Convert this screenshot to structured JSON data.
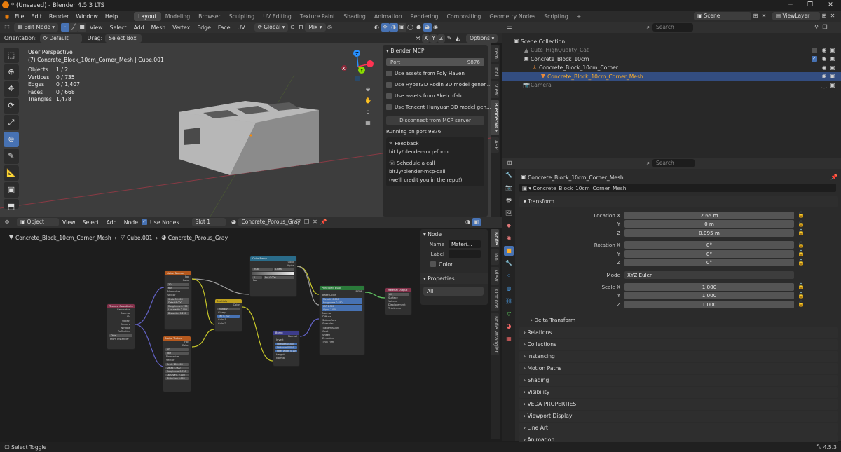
{
  "window": {
    "title": "* (Unsaved) - Blender 4.5.3 LTS",
    "min": "─",
    "max": "❐",
    "close": "✕"
  },
  "menu": [
    "File",
    "Edit",
    "Render",
    "Window",
    "Help"
  ],
  "workspaces": [
    "Layout",
    "Modeling",
    "Browser",
    "Sculpting",
    "UV Editing",
    "Texture Paint",
    "Shading",
    "Animation",
    "Rendering",
    "Compositing",
    "Geometry Nodes",
    "Scripting"
  ],
  "workspace_add": "+",
  "scene": "Scene",
  "view_layer": "ViewLayer",
  "viewport_header": {
    "mode": "Edit Mode",
    "view": "View",
    "select": "Select",
    "add": "Add",
    "mesh": "Mesh",
    "vertex": "Vertex",
    "edge": "Edge",
    "face": "Face",
    "uv": "UV",
    "transform": "Global",
    "snap": "Mix",
    "options": "Options",
    "axes": [
      "X",
      "Y",
      "Z"
    ]
  },
  "viewport_sub": {
    "orientation_label": "Orientation:",
    "orientation": "Default",
    "drag_label": "Drag:",
    "drag": "Select Box"
  },
  "viewport_info": {
    "perspective": "User Perspective",
    "object": "(7) Concrete_Block_10cm_Corner_Mesh | Cube.001"
  },
  "stats": [
    {
      "k": "Objects",
      "v": "1 / 2"
    },
    {
      "k": "Vertices",
      "v": "0 / 735"
    },
    {
      "k": "Edges",
      "v": "0 / 1,407"
    },
    {
      "k": "Faces",
      "v": "0 / 668"
    },
    {
      "k": "Triangles",
      "v": "1,478"
    }
  ],
  "gizmo": {
    "x": "X",
    "y": "Y",
    "z": "Z"
  },
  "mcp": {
    "title": "Blender MCP",
    "port_label": "Port",
    "port_value": "9876",
    "options": [
      "Use assets from Poly Haven",
      "Use Hyper3D Rodin 3D model gener...",
      "Use assets from Sketchfab",
      "Use Tencent Hunyuan 3D model gen..."
    ],
    "disconnect": "Disconnect from MCP server",
    "running": "Running on port 9876",
    "feedback": "Feedback",
    "feedback_url": "bit.ly/blender-mcp-form",
    "schedule": "Schedule a call",
    "schedule_url": "bit.ly/blender-mcp-call",
    "credit": "(we'll credit you in the repo!)"
  },
  "viewport_tabs": [
    "Item",
    "Tool",
    "View",
    "BlenderMCP",
    "ASP"
  ],
  "node_header": {
    "type": "Object",
    "view": "View",
    "select": "Select",
    "add": "Add",
    "node": "Node",
    "use_nodes": "Use Nodes",
    "slot": "Slot 1",
    "material": "Concrete_Porous_Gray"
  },
  "node_breadcrumb": [
    "Concrete_Block_10cm_Corner_Mesh",
    "Cube.001",
    "Concrete_Porous_Gray"
  ],
  "node_panel": {
    "title": "Node",
    "name_label": "Name",
    "name_value": "Materi...",
    "label_label": "Label",
    "color": "Color",
    "properties": "Properties",
    "all": "All"
  },
  "node_tabs": [
    "Node",
    "Tool",
    "View",
    "Options",
    "Node Wrangler"
  ],
  "nodes": {
    "texcoord": {
      "title": "Texture Coordinate",
      "outputs": [
        "Generated",
        "Normal",
        "UV",
        "Object",
        "Camera",
        "Window",
        "Reflection"
      ],
      "obj": "Obje...",
      "from_instancer": "From Instancer"
    },
    "noise1": {
      "title": "Noise Texture",
      "outputs": [
        "Fac",
        "Color"
      ],
      "dim": "3D",
      "type": "fBM",
      "normalize": "Normalize",
      "vector": "Vector",
      "fields": [
        "Scale 50.000",
        "Detail 8.000",
        "Roughness 0.700",
        "Lacunarity 2.000",
        "Distortion 0.200"
      ]
    },
    "noise2": {
      "title": "Noise Texture",
      "outputs": [
        "Fac",
        "Color"
      ],
      "dim": "3D",
      "type": "fBM",
      "normalize": "Normalize",
      "vector": "Vector",
      "fields": [
        "Scale 200.000",
        "Detail 5.000",
        "Roughness 0.700",
        "Lacunari.. 2.000",
        "Distortion 0.000"
      ]
    },
    "multiply": {
      "title": "Multiply",
      "result": "Color",
      "op": "Multiply",
      "clamp": "Clamp",
      "fac": "Fac 0.700",
      "inputs": [
        "Color1",
        "Color2"
      ]
    },
    "colorramp": {
      "title": "Color Ramp",
      "outputs": [
        "Color",
        "Alpha"
      ],
      "mode": "RGB",
      "interp": "Linear",
      "pos": "0",
      "pos_val": "Pos 0.000",
      "fac": "Fac"
    },
    "bsdf": {
      "title": "Principled BSDF",
      "output": "BSDF",
      "fields": [
        "Metallic 0.000",
        "Roughness 0.850",
        "IOR 1.500",
        "Alpha 1.000"
      ],
      "base": "Base Color",
      "rows": [
        "Normal",
        "Diffuse",
        "Subsurface",
        "Specular",
        "Transmission",
        "Coat",
        "Sheen",
        "Emission",
        "Thin Film"
      ]
    },
    "bump": {
      "title": "Bump",
      "output": "Normal",
      "invert": "Invert",
      "fields": [
        "Strength 0.300",
        "Distance 0.004",
        "Filter Width 0.100"
      ],
      "rows": [
        "Height",
        "Normal"
      ]
    },
    "output": {
      "title": "Material Output",
      "target": "All",
      "rows": [
        "Surface",
        "Volume",
        "Displacement",
        "Thickness"
      ]
    }
  },
  "outliner": {
    "search": "Search",
    "rows": [
      {
        "label": "Scene Collection"
      },
      {
        "label": "Cute_HighQuality_Cat"
      },
      {
        "label": "Concrete_Block_10cm"
      },
      {
        "label": "Concrete_Block_10cm_Corner"
      },
      {
        "label": "Concrete_Block_10cm_Corner_Mesh"
      },
      {
        "label": "Camera"
      }
    ]
  },
  "properties": {
    "search": "Search",
    "object_name": "Concrete_Block_10cm_Corner_Mesh",
    "object_field": "Concrete_Block_10cm_Corner_Mesh",
    "transform": "Transform",
    "location": {
      "label": "Location X",
      "x": "2.65 m",
      "y": "0 m",
      "z": "0.095 m"
    },
    "rotation": {
      "label": "Rotation X",
      "x": "0°",
      "y": "0°",
      "z": "0°"
    },
    "mode_label": "Mode",
    "mode": "XYZ Euler",
    "scale": {
      "label": "Scale X",
      "x": "1.000",
      "y": "1.000",
      "z": "1.000"
    },
    "y_label": "Y",
    "z_label": "Z",
    "delta": "Delta Transform",
    "panels": [
      "Relations",
      "Collections",
      "Instancing",
      "Motion Paths",
      "Shading",
      "Visibility",
      "VEDA PROPERTIES",
      "Viewport Display",
      "Line Art",
      "Animation"
    ]
  },
  "status": {
    "left": "Select Toggle",
    "version": "4.5.3"
  },
  "colors": {
    "accent": "#4772b3",
    "selected_text": "#ffaf29",
    "x_axis": "#ff3352",
    "y_axis": "#8bdc00",
    "z_axis": "#2890ff"
  }
}
